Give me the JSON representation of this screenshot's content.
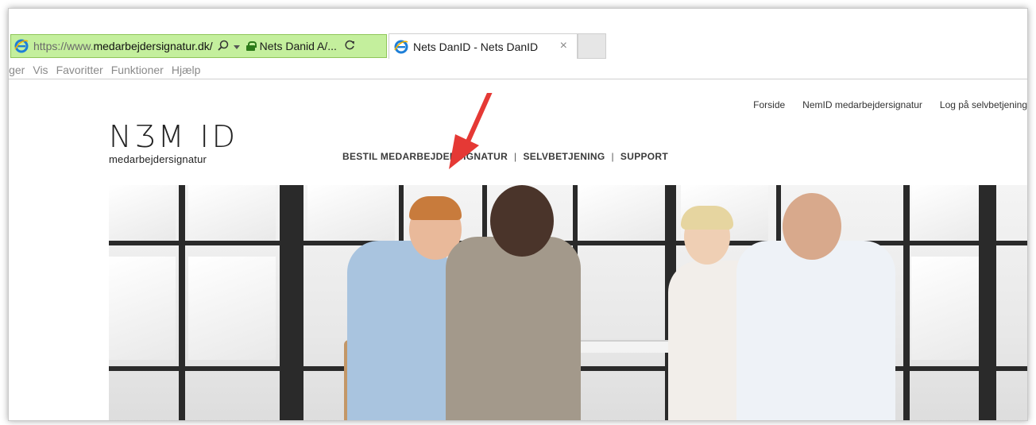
{
  "browser": {
    "url_scheme": "https://www.",
    "url_host": "medarbejdersignatur.dk/",
    "search_icon": "search-icon",
    "dropdown_icon": "chevron-down-icon",
    "cert_label": "Nets Danid A/...",
    "refresh_icon": "refresh-icon",
    "tab_title": "Nets DanID - Nets DanID",
    "tab_close": "×",
    "colors": {
      "address_bg": "#c4ef9d",
      "annotation_arrow": "#e53935"
    }
  },
  "menubar": {
    "items": [
      "iger",
      "Vis",
      "Favoritter",
      "Funktioner",
      "Hjælp"
    ]
  },
  "site": {
    "topnav": [
      "Forside",
      "NemID medarbejdersignatur",
      "Log på selvbetjening"
    ],
    "logo": {
      "title": "NƷM ID",
      "subtitle": "medarbejdersignatur"
    },
    "mainnav": [
      "BESTIL MEDARBEJDERSIGNATUR",
      "SELVBETJENING",
      "SUPPORT"
    ],
    "separator": "|"
  }
}
